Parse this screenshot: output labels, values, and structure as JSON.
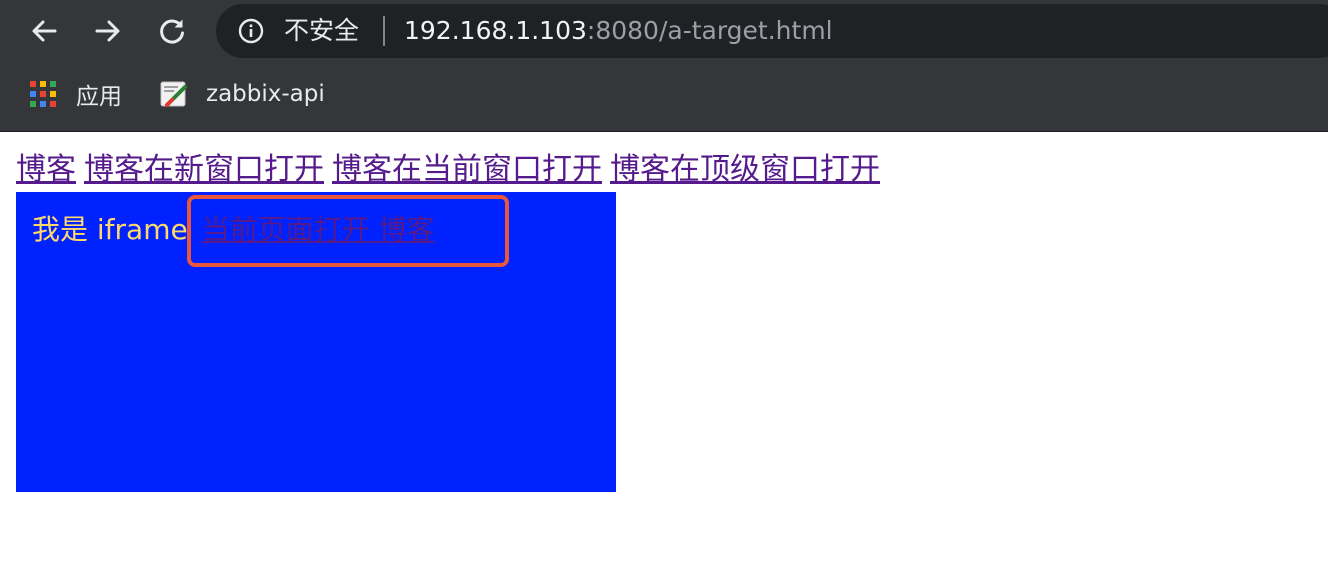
{
  "browser": {
    "omnibox": {
      "security_label": "不安全",
      "url_host": "192.168.1.103",
      "url_rest": ":8080/a-target.html"
    },
    "nav_icons": [
      "back-arrow-icon",
      "forward-arrow-icon",
      "reload-icon",
      "info-icon"
    ],
    "bookmarks": [
      {
        "icon": "apps-grid-icon",
        "label": "应用"
      },
      {
        "icon": "zabbix-favicon-icon",
        "label": "zabbix-api"
      }
    ]
  },
  "page": {
    "links": [
      {
        "label": "博客"
      },
      {
        "label": "博客在新窗口打开"
      },
      {
        "label": "博客在当前窗口打开"
      },
      {
        "label": "博客在顶级窗口打开"
      }
    ],
    "iframe": {
      "label": "我是 iframe",
      "link_label": "当前页面打开 博客"
    }
  },
  "colors": {
    "chrome_bg": "#35363a",
    "omnibox_bg": "#202124",
    "link": "#551a8b",
    "iframe_bg": "#0022ff",
    "iframe_text": "#ffd86b",
    "highlight": "#e8573c"
  }
}
